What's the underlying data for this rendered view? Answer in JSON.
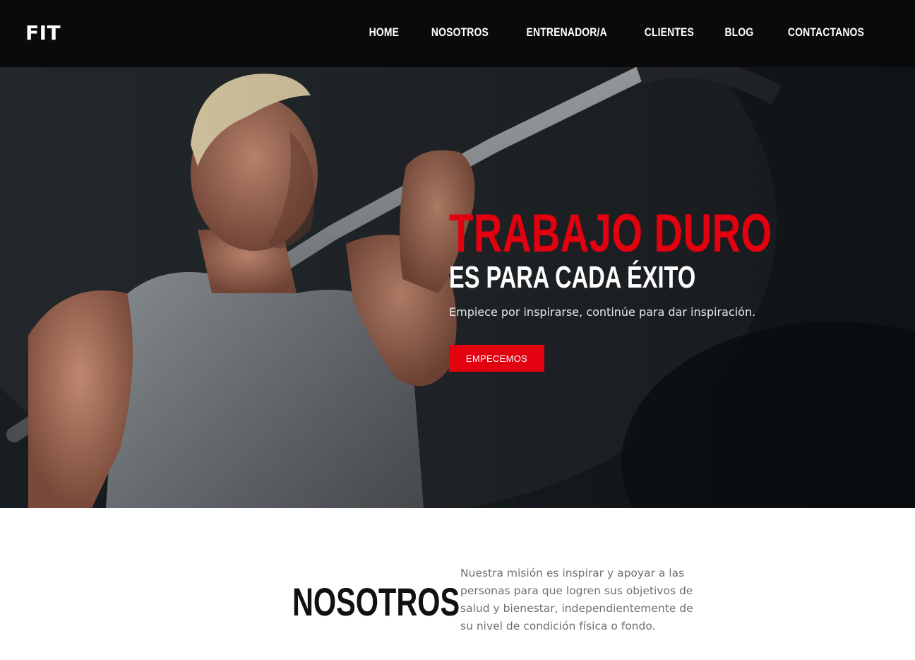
{
  "nav": {
    "brand": "FIT",
    "links": [
      "HOME",
      "NOSOTROS",
      "ENTRENADOR/A",
      "CLIENTES",
      "BLOG",
      "CONTACTANOS"
    ]
  },
  "hero": {
    "title": "TRABAJO DURO",
    "subtitle": "ES PARA CADA ÉXITO",
    "tagline": "Empiece por inspirarse, continúe para dar inspiración.",
    "cta_label": "EMPECEMOS",
    "image_subject": "man lifting barbell"
  },
  "about": {
    "title": "NOSOTROS",
    "text": "Nuestra misión es inspirar y apoyar a las personas para que logren sus objetivos de salud y bienestar, independientemente de su nivel de condición física o fondo."
  },
  "colors": {
    "accent": "#e3000f",
    "navbar_bg": "#0a0a0a",
    "heading_dark": "#111111",
    "body_text": "#6f6f6f"
  }
}
